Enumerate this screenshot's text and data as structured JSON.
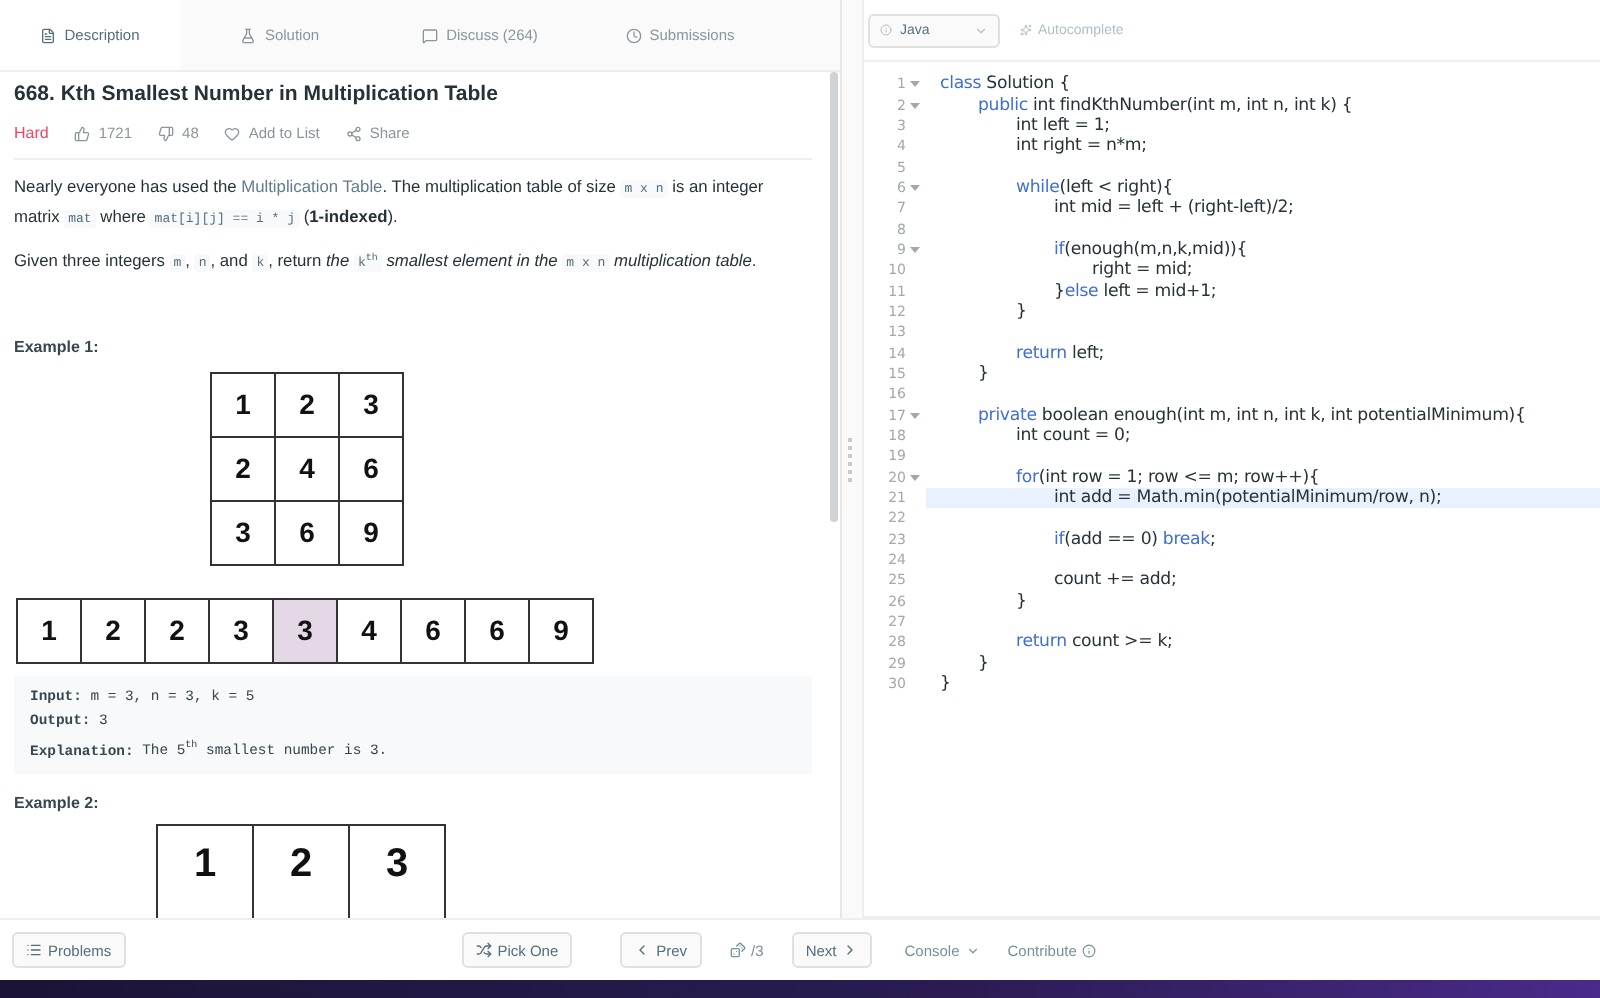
{
  "tabs": [
    {
      "kind": "description",
      "label": "Description",
      "selected": true
    },
    {
      "kind": "solution",
      "label": "Solution",
      "selected": false
    },
    {
      "kind": "discuss",
      "label": "Discuss (264)",
      "selected": false
    },
    {
      "kind": "submissions",
      "label": "Submissions",
      "selected": false
    }
  ],
  "problem": {
    "title": "668. Kth Smallest Number in Multiplication Table",
    "difficulty": "Hard",
    "likes": "1721",
    "dislikes": "48",
    "add_to_list": "Add to List",
    "share": "Share",
    "paragraphs": [
      [
        {
          "kind": "text",
          "t": "Nearly everyone has used the "
        },
        {
          "kind": "link",
          "t": "Multiplication Table"
        },
        {
          "kind": "text",
          "t": ". The multiplication table of size "
        },
        {
          "kind": "code",
          "t": "m x n"
        },
        {
          "kind": "text",
          "t": " is an integer matrix "
        },
        {
          "kind": "code",
          "t": "mat"
        },
        {
          "kind": "text",
          "t": " where "
        },
        {
          "kind": "code",
          "t": "mat[i][j] == i * j"
        },
        {
          "kind": "text",
          "t": " (**1-indexed**)."
        }
      ],
      [
        {
          "kind": "text",
          "t": "Given three integers "
        },
        {
          "kind": "code",
          "t": "m"
        },
        {
          "kind": "text",
          "t": ", "
        },
        {
          "kind": "code",
          "t": "n"
        },
        {
          "kind": "text",
          "t": ", and "
        },
        {
          "kind": "code",
          "t": "k"
        },
        {
          "kind": "text",
          "t": ", return *the* "
        },
        {
          "kind": "code",
          "t": "k$^{th}$"
        },
        {
          "kind": "text",
          "t": " *smallest element in the* "
        },
        {
          "kind": "code",
          "t": "m x n"
        },
        {
          "kind": "text",
          "t": " *multiplication table*."
        }
      ]
    ],
    "examples": [
      {
        "label": "Example 1:",
        "grid": [
          [
            "1",
            "2",
            "3"
          ],
          [
            "2",
            "4",
            "6"
          ],
          [
            "3",
            "6",
            "9"
          ]
        ],
        "continues": false,
        "sorted": [
          {
            "v": "1",
            "selected": false
          },
          {
            "v": "2",
            "selected": false
          },
          {
            "v": "2",
            "selected": false
          },
          {
            "v": "3",
            "selected": false
          },
          {
            "v": "3",
            "selected": true
          },
          {
            "v": "4",
            "selected": false
          },
          {
            "v": "6",
            "selected": false
          },
          {
            "v": "6",
            "selected": false
          },
          {
            "v": "9",
            "selected": false
          }
        ],
        "io": [
          {
            "label": "Input:",
            "value": "m = 3, n = 3, k = 5"
          },
          {
            "label": "Output:",
            "value": "3"
          },
          {
            "label": "Explanation:",
            "value": "The 5$^{th}$ smallest number is 3."
          }
        ]
      },
      {
        "label": "Example 2:",
        "grid": [
          [
            "1",
            "2",
            "3"
          ]
        ],
        "continues": true
      }
    ]
  },
  "editor": {
    "language": "Java",
    "autocomplete": "Autocomplete",
    "lines": [
      {
        "number": "1",
        "fold": true,
        "tokens": [
          {
            "kind": "kw",
            "t": "class"
          },
          {
            "kind": "id",
            "t": " Solution {"
          }
        ]
      },
      {
        "number": "2",
        "fold": true,
        "tokens": [
          {
            "kind": "kw",
            "t": "\tpublic"
          },
          {
            "kind": "id",
            "t": " int findKthNumber(int m, int n, int k) {"
          }
        ]
      },
      {
        "number": "3",
        "tokens": [
          {
            "kind": "id",
            "t": "\t\tint left = 1;"
          }
        ]
      },
      {
        "number": "4",
        "tokens": [
          {
            "kind": "id",
            "t": "\t\tint right = n*m;"
          }
        ]
      },
      {
        "number": "5"
      },
      {
        "number": "6",
        "fold": true,
        "tokens": [
          {
            "kind": "kw",
            "t": "\t\twhile"
          },
          {
            "kind": "id",
            "t": "(left < right){"
          }
        ]
      },
      {
        "number": "7",
        "tokens": [
          {
            "kind": "id",
            "t": "\t\t\tint mid = left + (right-left)/2;"
          }
        ]
      },
      {
        "number": "8"
      },
      {
        "number": "9",
        "fold": true,
        "tokens": [
          {
            "kind": "kw",
            "t": "\t\t\tif"
          },
          {
            "kind": "id",
            "t": "(enough(m,n,k,mid)){"
          }
        ]
      },
      {
        "number": "10",
        "tokens": [
          {
            "kind": "id",
            "t": "\t\t\t\tright = mid;"
          }
        ]
      },
      {
        "number": "11",
        "tokens": [
          {
            "kind": "id",
            "t": "\t\t\t}"
          },
          {
            "kind": "kw",
            "t": "else"
          },
          {
            "kind": "id",
            "t": " left = mid+1;"
          }
        ]
      },
      {
        "number": "12",
        "tokens": [
          {
            "kind": "id",
            "t": "\t\t}"
          }
        ]
      },
      {
        "number": "13"
      },
      {
        "number": "14",
        "tokens": [
          {
            "kind": "kw",
            "t": "\t\treturn"
          },
          {
            "kind": "id",
            "t": " left;"
          }
        ]
      },
      {
        "number": "15",
        "tokens": [
          {
            "kind": "id",
            "t": "\t}"
          }
        ]
      },
      {
        "number": "16"
      },
      {
        "number": "17",
        "fold": true,
        "tokens": [
          {
            "kind": "kw",
            "t": "\tprivate"
          },
          {
            "kind": "id",
            "t": " boolean enough(int m, int n, int k, int potentialMinimum){"
          }
        ]
      },
      {
        "number": "18",
        "tokens": [
          {
            "kind": "id",
            "t": "\t\tint count = 0;"
          }
        ]
      },
      {
        "number": "19"
      },
      {
        "number": "20",
        "fold": true,
        "tokens": [
          {
            "kind": "kw",
            "t": "\t\tfor"
          },
          {
            "kind": "id",
            "t": "(int row = 1; row <= m; row++){"
          }
        ]
      },
      {
        "number": "21",
        "highlighted": true,
        "tokens": [
          {
            "kind": "id",
            "t": "\t\t\tint add = Math.min(potentialMinimum/row, n);"
          }
        ]
      },
      {
        "number": "22"
      },
      {
        "number": "23",
        "tokens": [
          {
            "kind": "kw",
            "t": "\t\t\tif"
          },
          {
            "kind": "id",
            "t": "(add == 0) "
          },
          {
            "kind": "kw",
            "t": "break"
          },
          {
            "kind": "id",
            "t": ";"
          }
        ]
      },
      {
        "number": "24"
      },
      {
        "number": "25",
        "tokens": [
          {
            "kind": "id",
            "t": "\t\t\tcount += add;"
          }
        ]
      },
      {
        "number": "26",
        "tokens": [
          {
            "kind": "id",
            "t": "\t\t}"
          }
        ]
      },
      {
        "number": "27"
      },
      {
        "number": "28",
        "tokens": [
          {
            "kind": "kw",
            "t": "\t\treturn"
          },
          {
            "kind": "id",
            "t": " count >= k;"
          }
        ]
      },
      {
        "number": "29",
        "tokens": [
          {
            "kind": "id",
            "t": "\t}"
          }
        ]
      },
      {
        "number": "30",
        "tokens": [
          {
            "kind": "id",
            "t": "}"
          }
        ]
      }
    ]
  },
  "bottom_bar": {
    "problems": "Problems",
    "pick_one": "Pick One",
    "prev": "Prev",
    "page": "/3",
    "next": "Next",
    "console": "Console",
    "contribute": "Contribute"
  }
}
